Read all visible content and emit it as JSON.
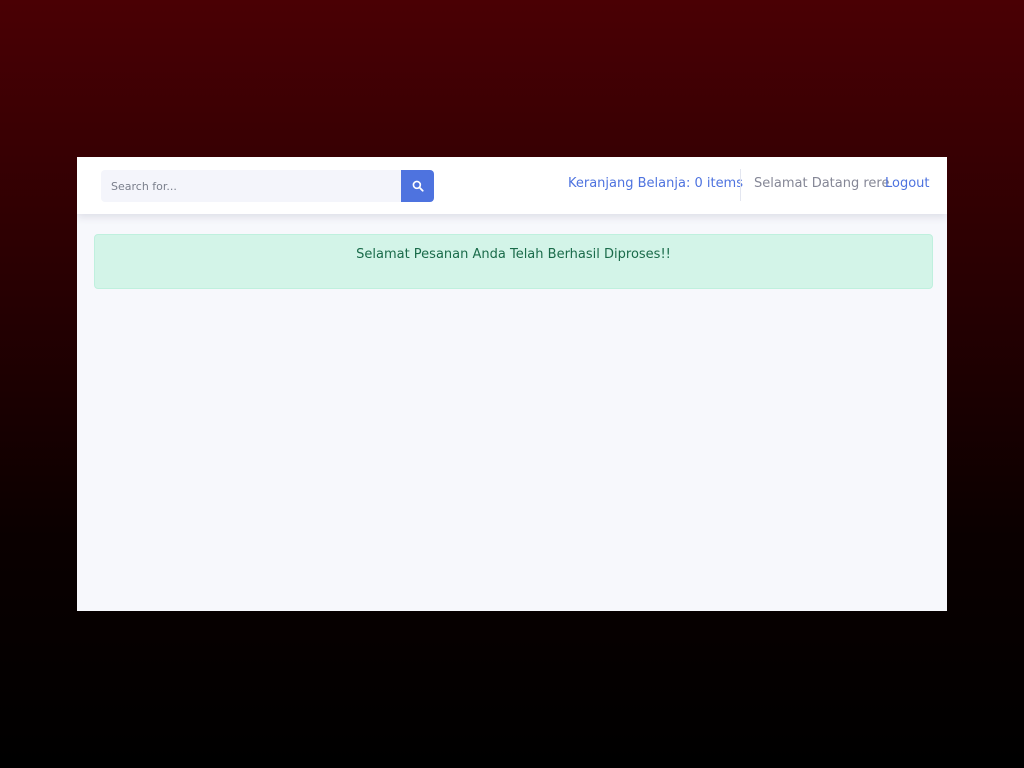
{
  "search": {
    "placeholder": "Search for...",
    "button_icon": "search-icon"
  },
  "topbar": {
    "cart_label": "Keranjang Belanja: 0 items",
    "welcome_text": "Selamat Datang rere",
    "logout_label": "Logout"
  },
  "alert": {
    "message": "Selamat Pesanan Anda Telah Berhasil Diproses!!"
  },
  "colors": {
    "accent": "#4e73df",
    "alert_bg": "#d3f4e8",
    "alert_text": "#1a6b4a",
    "muted_text": "#858796",
    "content_bg": "#f7f8fc"
  }
}
